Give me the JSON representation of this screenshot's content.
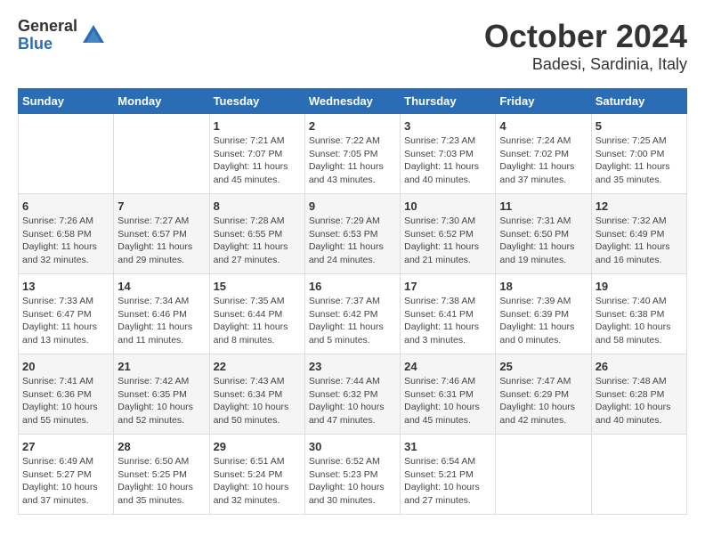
{
  "logo": {
    "general": "General",
    "blue": "Blue"
  },
  "title": "October 2024",
  "subtitle": "Badesi, Sardinia, Italy",
  "weekdays": [
    "Sunday",
    "Monday",
    "Tuesday",
    "Wednesday",
    "Thursday",
    "Friday",
    "Saturday"
  ],
  "weeks": [
    [
      {
        "day": "",
        "info": ""
      },
      {
        "day": "",
        "info": ""
      },
      {
        "day": "1",
        "info": "Sunrise: 7:21 AM\nSunset: 7:07 PM\nDaylight: 11 hours and 45 minutes."
      },
      {
        "day": "2",
        "info": "Sunrise: 7:22 AM\nSunset: 7:05 PM\nDaylight: 11 hours and 43 minutes."
      },
      {
        "day": "3",
        "info": "Sunrise: 7:23 AM\nSunset: 7:03 PM\nDaylight: 11 hours and 40 minutes."
      },
      {
        "day": "4",
        "info": "Sunrise: 7:24 AM\nSunset: 7:02 PM\nDaylight: 11 hours and 37 minutes."
      },
      {
        "day": "5",
        "info": "Sunrise: 7:25 AM\nSunset: 7:00 PM\nDaylight: 11 hours and 35 minutes."
      }
    ],
    [
      {
        "day": "6",
        "info": "Sunrise: 7:26 AM\nSunset: 6:58 PM\nDaylight: 11 hours and 32 minutes."
      },
      {
        "day": "7",
        "info": "Sunrise: 7:27 AM\nSunset: 6:57 PM\nDaylight: 11 hours and 29 minutes."
      },
      {
        "day": "8",
        "info": "Sunrise: 7:28 AM\nSunset: 6:55 PM\nDaylight: 11 hours and 27 minutes."
      },
      {
        "day": "9",
        "info": "Sunrise: 7:29 AM\nSunset: 6:53 PM\nDaylight: 11 hours and 24 minutes."
      },
      {
        "day": "10",
        "info": "Sunrise: 7:30 AM\nSunset: 6:52 PM\nDaylight: 11 hours and 21 minutes."
      },
      {
        "day": "11",
        "info": "Sunrise: 7:31 AM\nSunset: 6:50 PM\nDaylight: 11 hours and 19 minutes."
      },
      {
        "day": "12",
        "info": "Sunrise: 7:32 AM\nSunset: 6:49 PM\nDaylight: 11 hours and 16 minutes."
      }
    ],
    [
      {
        "day": "13",
        "info": "Sunrise: 7:33 AM\nSunset: 6:47 PM\nDaylight: 11 hours and 13 minutes."
      },
      {
        "day": "14",
        "info": "Sunrise: 7:34 AM\nSunset: 6:46 PM\nDaylight: 11 hours and 11 minutes."
      },
      {
        "day": "15",
        "info": "Sunrise: 7:35 AM\nSunset: 6:44 PM\nDaylight: 11 hours and 8 minutes."
      },
      {
        "day": "16",
        "info": "Sunrise: 7:37 AM\nSunset: 6:42 PM\nDaylight: 11 hours and 5 minutes."
      },
      {
        "day": "17",
        "info": "Sunrise: 7:38 AM\nSunset: 6:41 PM\nDaylight: 11 hours and 3 minutes."
      },
      {
        "day": "18",
        "info": "Sunrise: 7:39 AM\nSunset: 6:39 PM\nDaylight: 11 hours and 0 minutes."
      },
      {
        "day": "19",
        "info": "Sunrise: 7:40 AM\nSunset: 6:38 PM\nDaylight: 10 hours and 58 minutes."
      }
    ],
    [
      {
        "day": "20",
        "info": "Sunrise: 7:41 AM\nSunset: 6:36 PM\nDaylight: 10 hours and 55 minutes."
      },
      {
        "day": "21",
        "info": "Sunrise: 7:42 AM\nSunset: 6:35 PM\nDaylight: 10 hours and 52 minutes."
      },
      {
        "day": "22",
        "info": "Sunrise: 7:43 AM\nSunset: 6:34 PM\nDaylight: 10 hours and 50 minutes."
      },
      {
        "day": "23",
        "info": "Sunrise: 7:44 AM\nSunset: 6:32 PM\nDaylight: 10 hours and 47 minutes."
      },
      {
        "day": "24",
        "info": "Sunrise: 7:46 AM\nSunset: 6:31 PM\nDaylight: 10 hours and 45 minutes."
      },
      {
        "day": "25",
        "info": "Sunrise: 7:47 AM\nSunset: 6:29 PM\nDaylight: 10 hours and 42 minutes."
      },
      {
        "day": "26",
        "info": "Sunrise: 7:48 AM\nSunset: 6:28 PM\nDaylight: 10 hours and 40 minutes."
      }
    ],
    [
      {
        "day": "27",
        "info": "Sunrise: 6:49 AM\nSunset: 5:27 PM\nDaylight: 10 hours and 37 minutes."
      },
      {
        "day": "28",
        "info": "Sunrise: 6:50 AM\nSunset: 5:25 PM\nDaylight: 10 hours and 35 minutes."
      },
      {
        "day": "29",
        "info": "Sunrise: 6:51 AM\nSunset: 5:24 PM\nDaylight: 10 hours and 32 minutes."
      },
      {
        "day": "30",
        "info": "Sunrise: 6:52 AM\nSunset: 5:23 PM\nDaylight: 10 hours and 30 minutes."
      },
      {
        "day": "31",
        "info": "Sunrise: 6:54 AM\nSunset: 5:21 PM\nDaylight: 10 hours and 27 minutes."
      },
      {
        "day": "",
        "info": ""
      },
      {
        "day": "",
        "info": ""
      }
    ]
  ]
}
